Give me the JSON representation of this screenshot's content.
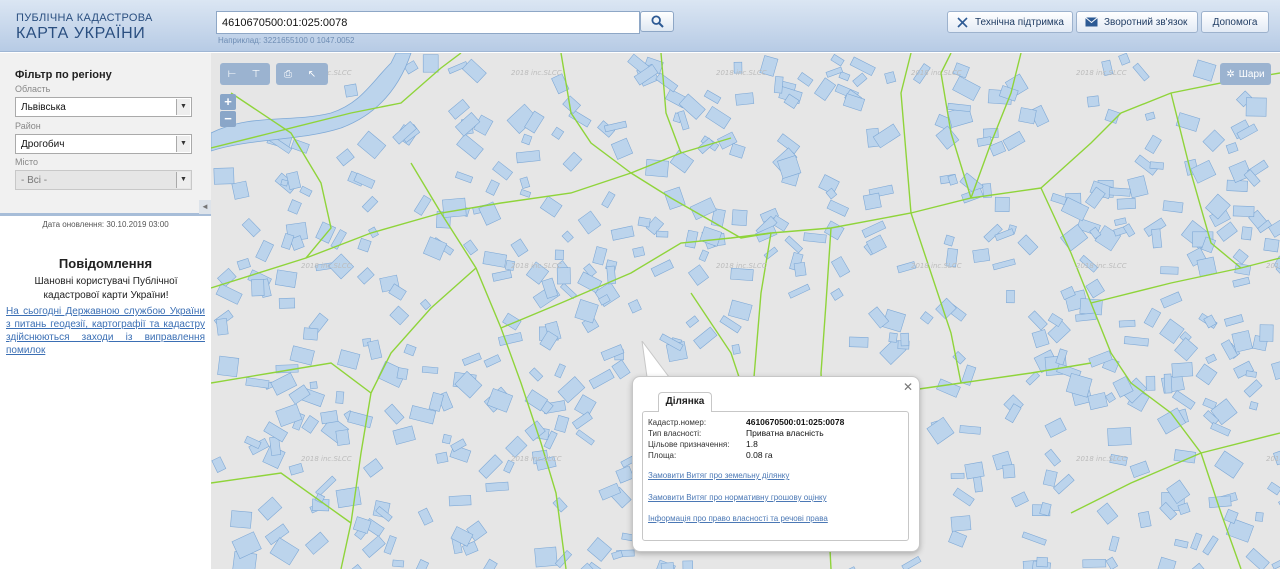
{
  "header": {
    "logo_line1": "ПУБЛІЧНА КАДАСТРОВА",
    "logo_line2": "КАРТА УКРАЇНИ",
    "search_value": "4610670500:01:025:0078",
    "search_hint": "Наприклад: 3221655100 0 1047.0052",
    "support_label": "Технічна підтримка",
    "feedback_label": "Зворотний зв'язок",
    "help_label": "Допомога"
  },
  "filter": {
    "title": "Фільтр по регіону",
    "oblast_label": "Область",
    "oblast_value": "Львівська",
    "raion_label": "Район",
    "raion_value": "Дрогобич",
    "city_label": "Місто",
    "city_value": "- Всі -"
  },
  "updated": "Дата оновлення: 30.10.2019 03:00",
  "notice": {
    "title": "Повідомлення",
    "greeting": "Шановні користувачі Публічної кадастрової карти України!",
    "link_text": "На сьогодні Державною службою України з питань геодезії, картографії та кадастру здійснюються заходи із виправлення помилок"
  },
  "map": {
    "layers_label": "Шари",
    "watermark": "2018 inc.SLCC"
  },
  "popup": {
    "tab_label": "Ділянка",
    "rows": [
      {
        "key": "Кадастр.номер:",
        "value": "4610670500:01:025:0078"
      },
      {
        "key": "Тип власності:",
        "value": "Приватна власність"
      },
      {
        "key": "Цільове призначення:",
        "value": "1.8"
      },
      {
        "key": "Площа:",
        "value": "0.08 га"
      }
    ],
    "links": [
      "Замовити Витяг про земельну ділянку",
      "Замовити Витяг про нормативну грошову оцінку",
      "Інформація про право власності та речові права"
    ]
  },
  "colors": {
    "parcel_fill": "#bcd4ec",
    "parcel_stroke": "#7fa9d6",
    "boundary": "#8fd43a",
    "map_bg": "#e6e6e6",
    "header_text": "#2a4f80"
  }
}
